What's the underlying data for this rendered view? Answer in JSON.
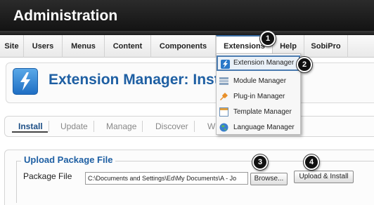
{
  "header": {
    "title": "Administration"
  },
  "menubar": {
    "items": [
      "Site",
      "Users",
      "Menus",
      "Content",
      "Components",
      "Extensions",
      "Help",
      "SobiPro"
    ]
  },
  "extensions_menu": {
    "items": [
      {
        "label": "Extension Manager",
        "icon": "extension-manager-icon"
      },
      {
        "label": "Module Manager",
        "icon": "module-manager-icon"
      },
      {
        "label": "Plug-in Manager",
        "icon": "plugin-manager-icon"
      },
      {
        "label": "Template Manager",
        "icon": "template-manager-icon"
      },
      {
        "label": "Language Manager",
        "icon": "language-manager-icon"
      }
    ]
  },
  "page": {
    "title": "Extension Manager: Insta"
  },
  "tabs": [
    "Install",
    "Update",
    "Manage",
    "Discover",
    "W"
  ],
  "upload": {
    "legend": "Upload Package File",
    "package_label": "Package File",
    "file_value": "C:\\Documents and Settings\\Ed\\My Documents\\A - Jo",
    "browse_label": "Browse...",
    "install_label": "Upload & Install"
  },
  "callouts": [
    "1",
    "2",
    "3",
    "4"
  ],
  "colors": {
    "header_bg": "#1a1a1a",
    "title_blue": "#1e5fa3",
    "highlight_border": "#4b7bb0"
  }
}
